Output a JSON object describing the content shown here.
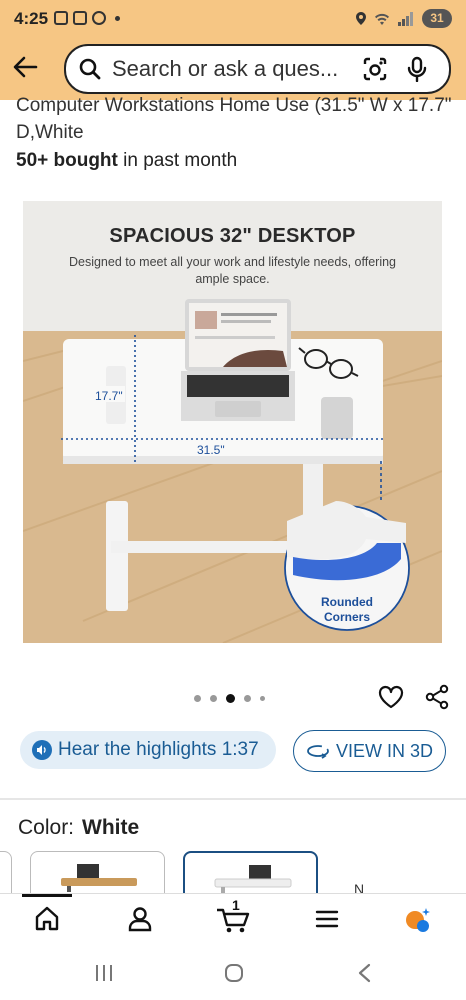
{
  "status": {
    "time": "4:25",
    "battery": "31"
  },
  "search": {
    "placeholder": "Search or ask a ques..."
  },
  "product": {
    "title": "Computer Workstations Home Use (31.5\" W x 17.7\" D,White",
    "bought_bold": "50+ bought",
    "bought_rest": " in past month"
  },
  "image": {
    "heading": "SPACIOUS 32\" DESKTOP",
    "subtext": "Designed to meet all your work and lifestyle needs, offering ample space.",
    "depth_label": "17.7\"",
    "width_label": "31.5\"",
    "corner_label": "Rounded Corners",
    "carousel_dots": 5,
    "carousel_active_index": 2
  },
  "actions": {
    "hear_label": "Hear the highlights 1:37",
    "view3d_label": "VIEW IN 3D"
  },
  "color": {
    "label": "Color:",
    "value": "White",
    "next_option_partial": "N"
  },
  "bottom_nav": {
    "cart_count": "1",
    "items": [
      "home-icon",
      "user-icon",
      "cart-icon",
      "menu-icon",
      "rufus-icon"
    ]
  },
  "colors": {
    "header_bg": "#f6c684",
    "link_blue": "#1a5c94",
    "selected_border": "#1b4f82"
  }
}
